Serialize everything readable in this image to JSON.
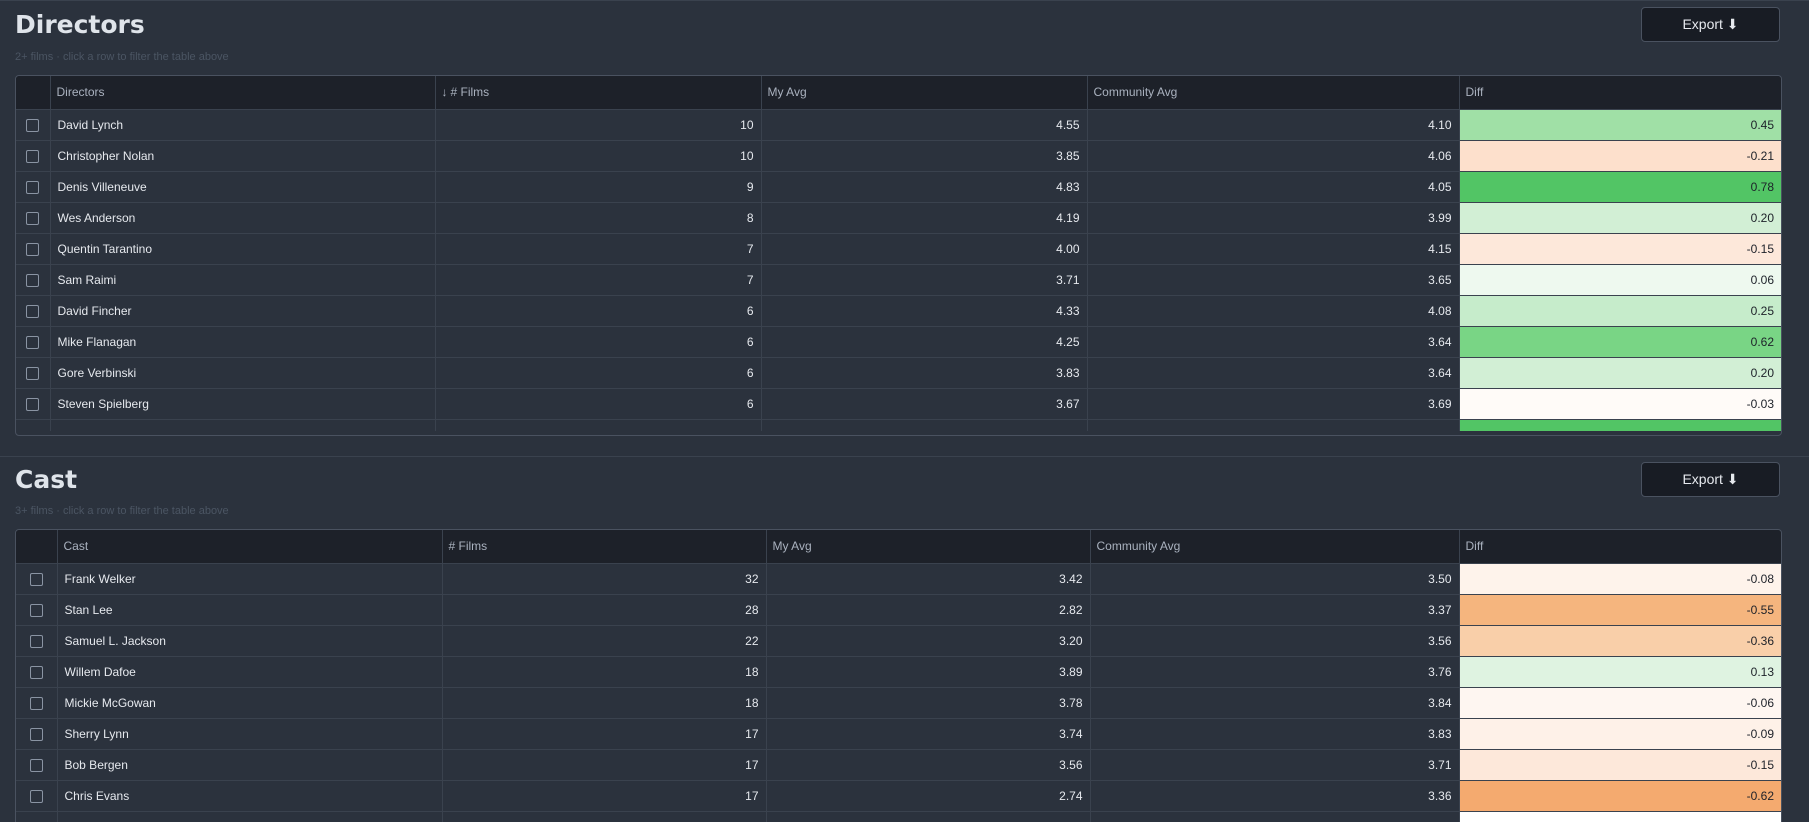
{
  "directors": {
    "title": "Directors",
    "subtitle": "2+ films · click a row to filter the table above",
    "export_label": "Export ⬇",
    "columns": {
      "name": "Directors",
      "sort_arrow": "↓",
      "films": "# Films",
      "my_avg": "My Avg",
      "community_avg": "Community Avg",
      "diff": "Diff"
    },
    "rows": [
      {
        "name": "David Lynch",
        "films": "10",
        "my_avg": "4.55",
        "community_avg": "4.10",
        "diff": "0.45",
        "color": "#a0e0a6"
      },
      {
        "name": "Christopher Nolan",
        "films": "10",
        "my_avg": "3.85",
        "community_avg": "4.06",
        "diff": "-0.21",
        "color": "#fde0cc"
      },
      {
        "name": "Denis Villeneuve",
        "films": "9",
        "my_avg": "4.83",
        "community_avg": "4.05",
        "diff": "0.78",
        "color": "#52c565"
      },
      {
        "name": "Wes Anderson",
        "films": "8",
        "my_avg": "4.19",
        "community_avg": "3.99",
        "diff": "0.20",
        "color": "#d2efd5"
      },
      {
        "name": "Quentin Tarantino",
        "films": "7",
        "my_avg": "4.00",
        "community_avg": "4.15",
        "diff": "-0.15",
        "color": "#fde8da"
      },
      {
        "name": "Sam Raimi",
        "films": "7",
        "my_avg": "3.71",
        "community_avg": "3.65",
        "diff": "0.06",
        "color": "#eef9ef"
      },
      {
        "name": "David Fincher",
        "films": "6",
        "my_avg": "4.33",
        "community_avg": "4.08",
        "diff": "0.25",
        "color": "#c6eccb"
      },
      {
        "name": "Mike Flanagan",
        "films": "6",
        "my_avg": "4.25",
        "community_avg": "3.64",
        "diff": "0.62",
        "color": "#79d585"
      },
      {
        "name": "Gore Verbinski",
        "films": "6",
        "my_avg": "3.83",
        "community_avg": "3.64",
        "diff": "0.20",
        "color": "#d2efd5"
      },
      {
        "name": "Steven Spielberg",
        "films": "6",
        "my_avg": "3.67",
        "community_avg": "3.69",
        "diff": "-0.03",
        "color": "#fffbf8"
      }
    ],
    "partial_row_color": "#52c565"
  },
  "cast": {
    "title": "Cast",
    "subtitle": "3+ films · click a row to filter the table above",
    "export_label": "Export ⬇",
    "columns": {
      "name": "Cast",
      "films": "# Films",
      "my_avg": "My Avg",
      "community_avg": "Community Avg",
      "diff": "Diff"
    },
    "rows": [
      {
        "name": "Frank Welker",
        "films": "32",
        "my_avg": "3.42",
        "community_avg": "3.50",
        "diff": "-0.08",
        "color": "#fef3eb"
      },
      {
        "name": "Stan Lee",
        "films": "28",
        "my_avg": "2.82",
        "community_avg": "3.37",
        "diff": "-0.55",
        "color": "#f5b57e"
      },
      {
        "name": "Samuel L. Jackson",
        "films": "22",
        "my_avg": "3.20",
        "community_avg": "3.56",
        "diff": "-0.36",
        "color": "#f9cfa9"
      },
      {
        "name": "Willem Dafoe",
        "films": "18",
        "my_avg": "3.89",
        "community_avg": "3.76",
        "diff": "0.13",
        "color": "#dff3e1"
      },
      {
        "name": "Mickie McGowan",
        "films": "18",
        "my_avg": "3.78",
        "community_avg": "3.84",
        "diff": "-0.06",
        "color": "#fef6f1"
      },
      {
        "name": "Sherry Lynn",
        "films": "17",
        "my_avg": "3.74",
        "community_avg": "3.83",
        "diff": "-0.09",
        "color": "#fef1e8"
      },
      {
        "name": "Bob Bergen",
        "films": "17",
        "my_avg": "3.56",
        "community_avg": "3.71",
        "diff": "-0.15",
        "color": "#fde8da"
      },
      {
        "name": "Chris Evans",
        "films": "17",
        "my_avg": "2.74",
        "community_avg": "3.36",
        "diff": "-0.62",
        "color": "#f4aa6f"
      }
    ],
    "partial_row_color": "#ffffff"
  }
}
